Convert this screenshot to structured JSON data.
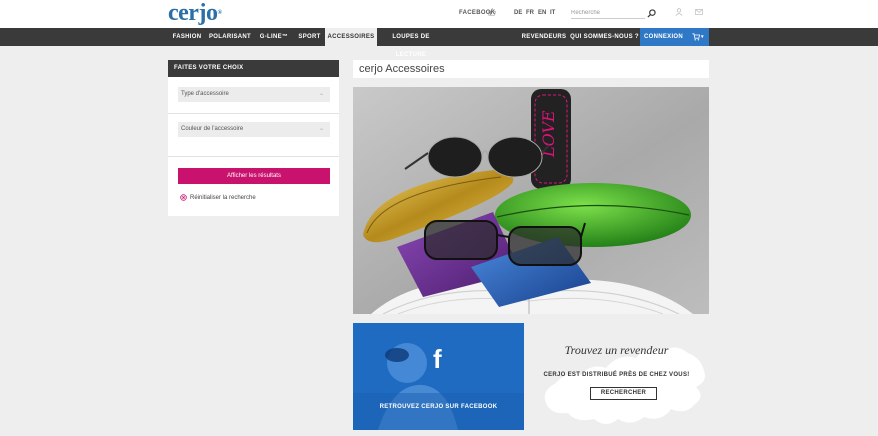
{
  "header": {
    "logo": "cerjo",
    "logo_mark": "®",
    "facebook_label": "FACEBOOK",
    "languages": [
      "DE",
      "FR",
      "EN",
      "IT"
    ],
    "search_placeholder": "Recherche"
  },
  "nav": {
    "items": [
      "FASHION",
      "POLARISANT",
      "G-LINE™",
      "SPORT",
      "ACCESSOIRES",
      "LOUPES DE LECTURE"
    ],
    "active": "ACCESSOIRES",
    "right_items": [
      "REVENDEURS",
      "QUI SOMMES-NOUS ?"
    ],
    "connexion": "CONNEXION",
    "cart_caret": "▾"
  },
  "filter": {
    "title": "FAITES VOTRE CHOIX",
    "select_type": "Type d'accessoire",
    "select_color": "Couleur de l'accessoire",
    "caret": "⌄",
    "show_results": "Afficher les résultats",
    "reset": "Réinitialiser la recherche"
  },
  "main": {
    "title": "cerjo Accessoires",
    "hero_case_text": "LOVE"
  },
  "facebook_panel": {
    "glyph": "f",
    "text": "RETROUVEZ CERJO SUR FACEBOOK"
  },
  "dealer_panel": {
    "title": "Trouvez un revendeur",
    "subtitle": "CERJO EST DISTRIBUÉ PRÈS DE CHEZ VOUS!",
    "button": "RECHERCHER"
  },
  "colors": {
    "accent_magenta": "#c8126e",
    "nav_dark": "#3a3a3a",
    "brand_blue": "#2e78c6",
    "facebook_blue": "#1f6bc2"
  },
  "icons": [
    "like-icon",
    "search-icon",
    "account-icon",
    "mail-icon",
    "cart-icon",
    "chevron-down-icon",
    "reset-icon",
    "facebook-icon"
  ]
}
